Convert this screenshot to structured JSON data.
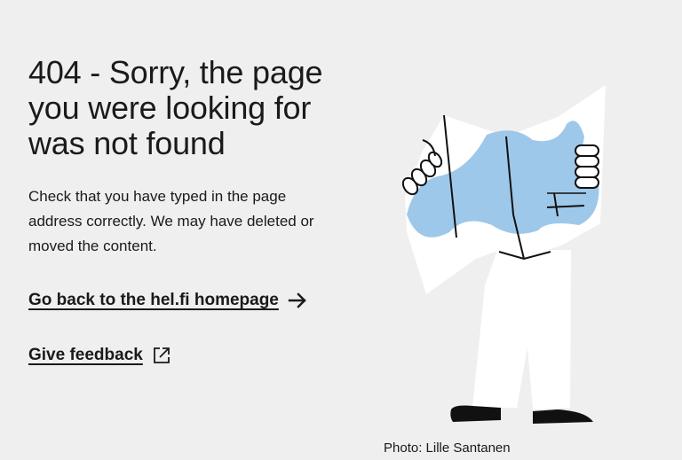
{
  "error": {
    "title": "404 - Sorry, the page you were looking for was not found",
    "description": "Check that you have typed in the page address correctly. We may have deleted or moved the content."
  },
  "links": {
    "home_label": "Go back to the hel.fi homepage",
    "home_icon": "arrow-right-icon",
    "feedback_label": "Give feedback",
    "feedback_icon": "external-link-icon"
  },
  "image": {
    "caption": "Photo: Lille Santanen",
    "subject": "person-reading-map-illustration"
  },
  "colors": {
    "background": "#efefef",
    "text": "#1a1a1a",
    "map_blue": "#9ec8ea",
    "figure_white": "#ffffff"
  }
}
